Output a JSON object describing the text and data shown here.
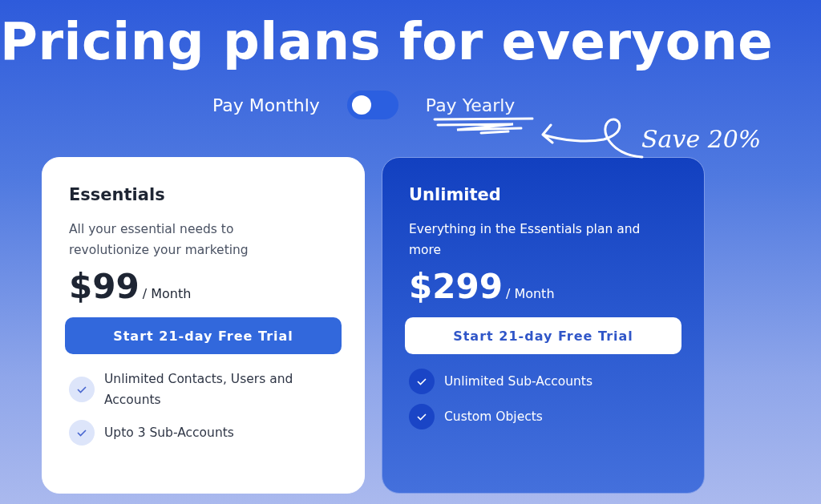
{
  "heading": "Pricing plans for everyone",
  "billing": {
    "monthly_label": "Pay Monthly",
    "yearly_label": "Pay Yearly",
    "on": false,
    "save_note": "Save 20%"
  },
  "plans": [
    {
      "name": "Essentials",
      "kind": "light",
      "description": "All your essential needs to revolutionize your marketing",
      "price": "$99",
      "period": "/ Month",
      "button": "Start 21-day Free Trial",
      "features": [
        "Unlimited Contacts, Users and Accounts",
        "Upto 3 Sub-Accounts"
      ]
    },
    {
      "name": "Unlimited",
      "kind": "dark",
      "description": "Everything in the Essentials plan and more",
      "price": "$299",
      "period": "/ Month",
      "button": "Start 21-day Free Trial",
      "features": [
        "Unlimited Sub-Accounts",
        "Custom Objects"
      ]
    }
  ]
}
